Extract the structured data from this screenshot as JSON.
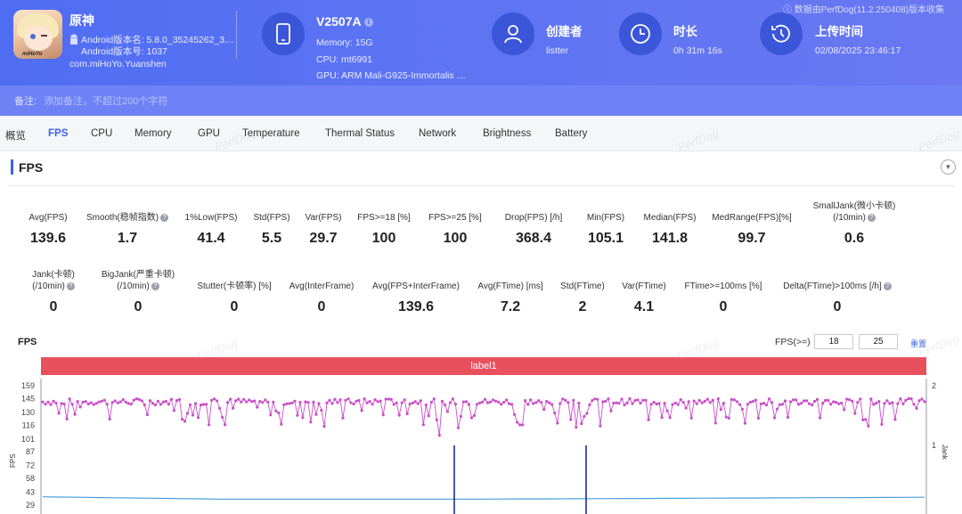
{
  "header": {
    "version_note": "ⓘ 数据由PerfDog(11.2.250408)版本收集",
    "app": {
      "name": "原神",
      "version_name": "Android版本名: 5.8.0_35245262_353...",
      "version_code": "Android版本号: 1037",
      "package": "com.miHoYo.Yuanshen",
      "icon": "genshin-app-icon",
      "icon_brand": "miHoYo"
    },
    "device": {
      "name": "V2507A",
      "memory": "Memory: 15G",
      "cpu": "CPU: mt6991",
      "gpu": "GPU: ARM Mali-G925-Immortalis M..."
    },
    "creator": {
      "title": "创建者",
      "value": "listter"
    },
    "duration": {
      "title": "时长",
      "value": "0h 31m 16s"
    },
    "upload": {
      "title": "上传时间",
      "value": "02/08/2025 23:46:17"
    },
    "note": {
      "label": "备注:",
      "placeholder": "添加备注，不超过200个字符"
    }
  },
  "tabs": [
    "概览",
    "FPS",
    "CPU",
    "Memory",
    "GPU",
    "Temperature",
    "Thermal Status",
    "Network",
    "Brightness",
    "Battery"
  ],
  "active_tab": "FPS",
  "section": {
    "title": "FPS"
  },
  "stats_row1": [
    {
      "label": "Avg(FPS)",
      "value": "139.6"
    },
    {
      "label": "Smooth(稳帧指数)",
      "value": "1.7",
      "help": true
    },
    {
      "label": "1%Low(FPS)",
      "value": "41.4"
    },
    {
      "label": "Std(FPS)",
      "value": "5.5"
    },
    {
      "label": "Var(FPS)",
      "value": "29.7"
    },
    {
      "label": "FPS>=18 [%]",
      "value": "100"
    },
    {
      "label": "FPS>=25 [%]",
      "value": "100"
    },
    {
      "label": "Drop(FPS) [/h]",
      "value": "368.4"
    },
    {
      "label": "Min(FPS)",
      "value": "105.1"
    },
    {
      "label": "Median(FPS)",
      "value": "141.8"
    },
    {
      "label": "MedRange(FPS)[%]",
      "value": "99.7"
    },
    {
      "label": "SmallJank(微小卡顿)",
      "label2": "(/10min)",
      "value": "0.6",
      "help": true
    }
  ],
  "stats_row2": [
    {
      "label": "Jank(卡顿)",
      "label2": "(/10min)",
      "value": "0",
      "help": true
    },
    {
      "label": "BigJank(严重卡顿)",
      "label2": "(/10min)",
      "value": "0",
      "help": true
    },
    {
      "label": "Stutter(卡顿率) [%]",
      "value": "0"
    },
    {
      "label": "Avg(InterFrame)",
      "value": "0"
    },
    {
      "label": "Avg(FPS+InterFrame)",
      "value": "139.6"
    },
    {
      "label": "Avg(FTime) [ms]",
      "value": "7.2"
    },
    {
      "label": "Std(FTime)",
      "value": "2"
    },
    {
      "label": "Var(FTime)",
      "value": "4.1"
    },
    {
      "label": "FTime>=100ms [%]",
      "value": "0"
    },
    {
      "label": "Delta(FTime)>100ms [/h]",
      "value": "0",
      "help": true
    }
  ],
  "chart": {
    "title": "FPS",
    "threshold_label": "FPS(>=)",
    "threshold1": "18",
    "threshold2": "25",
    "reset_label": "重置",
    "label_bar": "label1",
    "watermark": "PerfDog"
  },
  "chart_data": {
    "type": "line",
    "title": "FPS",
    "ylabel": "FPS",
    "y2label": "Jank",
    "y_ticks": [
      159,
      145,
      130,
      116,
      101,
      87,
      72,
      58,
      43,
      29
    ],
    "y2_ticks": [
      2,
      1
    ],
    "ylim": [
      29,
      159
    ],
    "y2lim": [
      0,
      2
    ],
    "series": [
      {
        "color": "#c94fc9",
        "approx_mean": 139.6,
        "min": 105.1,
        "typical_max": 145
      },
      {
        "color": "#4a9fd8",
        "approx_level": 36
      },
      {
        "color": "#1a2f8a",
        "spikes": [
          1,
          1
        ]
      }
    ],
    "grid": false
  },
  "colors": {
    "header_bg": "#5c73f3",
    "accent": "#3c64e6",
    "label_bar": "#e9505e",
    "fps_series": "#c94fc9",
    "line_series": "#4a9fd8"
  }
}
